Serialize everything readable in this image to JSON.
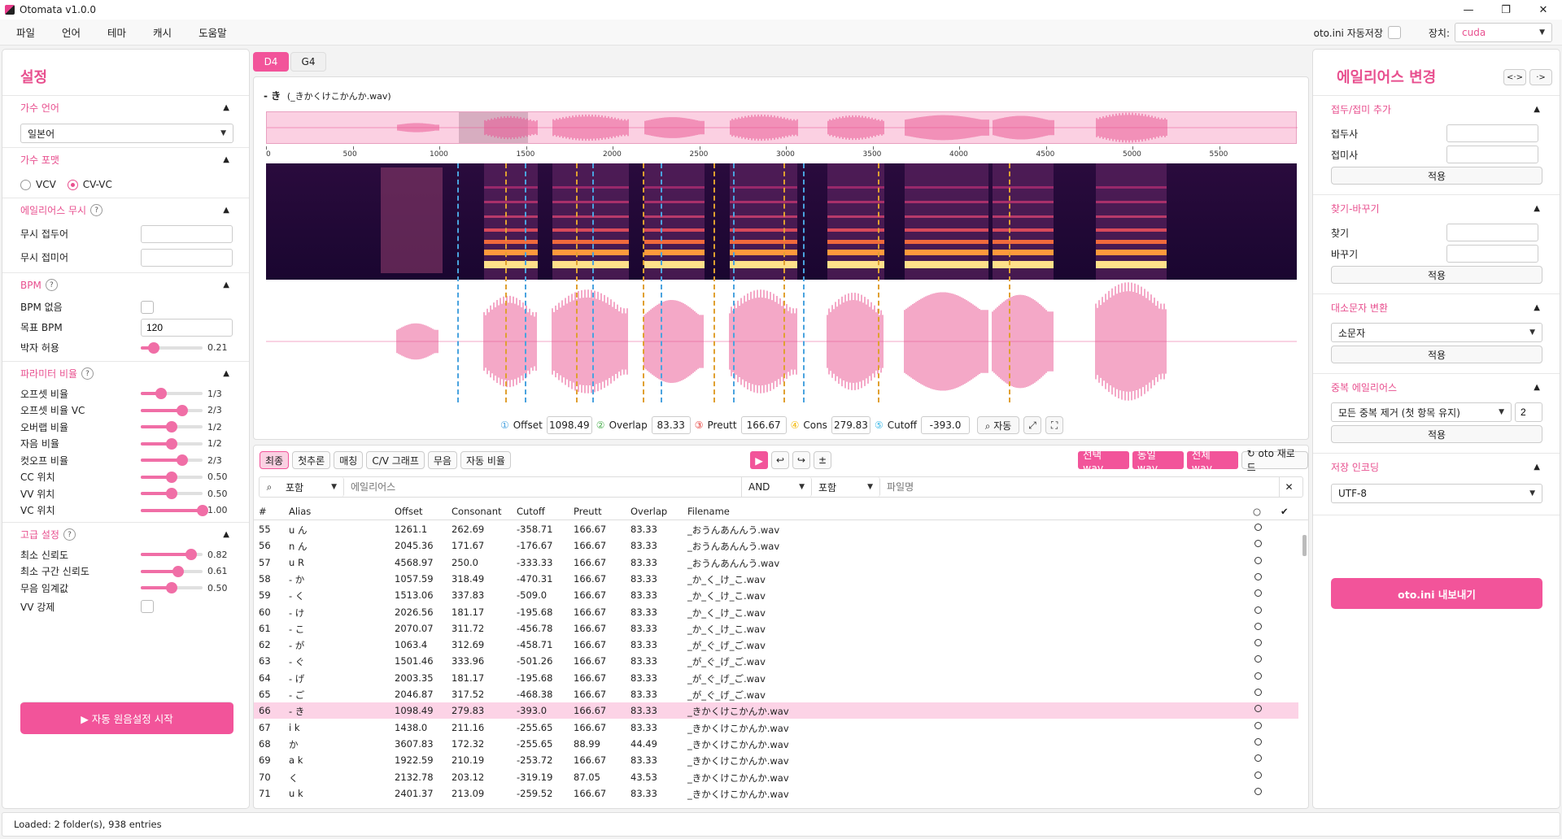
{
  "window": {
    "title": "Otomata v1.0.0"
  },
  "menu": {
    "items": [
      "파일",
      "언어",
      "테마",
      "캐시",
      "도움말"
    ],
    "autosave_label": "oto.ini 자동저장",
    "device_label": "장치:",
    "device_value": "cuda"
  },
  "left": {
    "title": "설정",
    "singer_lang": {
      "title": "가수 언어",
      "value": "일본어"
    },
    "singer_format": {
      "title": "가수 포맷",
      "opt1": "VCV",
      "opt2": "CV-VC",
      "selected": "CV-VC"
    },
    "ignore": {
      "title": "에일리어스 무시",
      "prefix": "무시 접두어",
      "suffix": "무시 접미어"
    },
    "bpm": {
      "title": "BPM",
      "none": "BPM 없음",
      "target": "목표 BPM",
      "target_value": "120",
      "tolerance": "박자 허용",
      "tolerance_value": "0.21",
      "tolerance_level": 0.21
    },
    "ratio": {
      "title": "파라미터 비율",
      "items": [
        {
          "label": "오프셋 비율",
          "value": "1/3",
          "level": 0.33
        },
        {
          "label": "오프셋 비율 VC",
          "value": "2/3",
          "level": 0.67
        },
        {
          "label": "오버랩 비율",
          "value": "1/2",
          "level": 0.5
        },
        {
          "label": "자음 비율",
          "value": "1/2",
          "level": 0.5
        },
        {
          "label": "컷오프 비율",
          "value": "2/3",
          "level": 0.67
        },
        {
          "label": "CC 위치",
          "value": "0.50",
          "level": 0.5
        },
        {
          "label": "VV 위치",
          "value": "0.50",
          "level": 0.5
        },
        {
          "label": "VC 위치",
          "value": "1.00",
          "level": 1.0
        }
      ]
    },
    "advanced": {
      "title": "고급 설정",
      "items": [
        {
          "label": "최소 신뢰도",
          "value": "0.82",
          "level": 0.82
        },
        {
          "label": "최소 구간 신뢰도",
          "value": "0.61",
          "level": 0.61
        },
        {
          "label": "무음 임계값",
          "value": "0.50",
          "level": 0.5
        }
      ],
      "vv_force": "VV 강제"
    },
    "start_button": "▶  자동 원음설정 시작"
  },
  "tabs": [
    "D4",
    "G4"
  ],
  "viewer": {
    "alias_title": "- き",
    "file_title": "(_きかくけこかんか.wav)",
    "ruler_ticks": [
      "0",
      "500",
      "1000",
      "1500",
      "2000",
      "2500",
      "3000",
      "3500",
      "4000",
      "4500",
      "5000",
      "5500"
    ],
    "params": {
      "offset_label": "Offset",
      "offset": "1098.49",
      "overlap_label": "Overlap",
      "overlap": "83.33",
      "preutt_label": "Preutt",
      "preutt": "166.67",
      "cons_label": "Cons",
      "cons": "279.83",
      "cutoff_label": "Cutoff",
      "cutoff": "-393.0",
      "auto_label": "⌕ 자동"
    },
    "colors": {
      "offset": "#4aa3df",
      "overlap": "#4caf50",
      "preutt": "#e53935",
      "cons": "#f2b705",
      "cutoff": "#35b6e6"
    }
  },
  "table": {
    "toolbar": [
      "최종",
      "첫추론",
      "매칭",
      "C/V 그래프",
      "무음",
      "자동 비율"
    ],
    "wav_buttons": [
      "선택 wav",
      "동일 wav",
      "전체 wav"
    ],
    "reload": "↻ oto 재로드",
    "filter": {
      "mode1": "포함",
      "alias_placeholder": "에일리어스",
      "op": "AND",
      "mode2": "포함",
      "file_placeholder": "파일명"
    },
    "columns": [
      "#",
      "Alias",
      "Offset",
      "Consonant",
      "Cutoff",
      "Preutt",
      "Overlap",
      "Filename",
      "○",
      "✔"
    ],
    "rows": [
      [
        "55",
        "u ん",
        "1261.1",
        "262.69",
        "-358.71",
        "166.67",
        "83.33",
        "_おうんあんんう.wav"
      ],
      [
        "56",
        "n ん",
        "2045.36",
        "171.67",
        "-176.67",
        "166.67",
        "83.33",
        "_おうんあんんう.wav"
      ],
      [
        "57",
        "u R",
        "4568.97",
        "250.0",
        "-333.33",
        "166.67",
        "83.33",
        "_おうんあんんう.wav"
      ],
      [
        "58",
        "- か",
        "1057.59",
        "318.49",
        "-470.31",
        "166.67",
        "83.33",
        "_か_く_け_こ.wav"
      ],
      [
        "59",
        "- く",
        "1513.06",
        "337.83",
        "-509.0",
        "166.67",
        "83.33",
        "_か_く_け_こ.wav"
      ],
      [
        "60",
        "- け",
        "2026.56",
        "181.17",
        "-195.68",
        "166.67",
        "83.33",
        "_か_く_け_こ.wav"
      ],
      [
        "61",
        "- こ",
        "2070.07",
        "311.72",
        "-456.78",
        "166.67",
        "83.33",
        "_か_く_け_こ.wav"
      ],
      [
        "62",
        "- が",
        "1063.4",
        "312.69",
        "-458.71",
        "166.67",
        "83.33",
        "_が_ぐ_げ_ご.wav"
      ],
      [
        "63",
        "- ぐ",
        "1501.46",
        "333.96",
        "-501.26",
        "166.67",
        "83.33",
        "_が_ぐ_げ_ご.wav"
      ],
      [
        "64",
        "- げ",
        "2003.35",
        "181.17",
        "-195.68",
        "166.67",
        "83.33",
        "_が_ぐ_げ_ご.wav"
      ],
      [
        "65",
        "- ご",
        "2046.87",
        "317.52",
        "-468.38",
        "166.67",
        "83.33",
        "_が_ぐ_げ_ご.wav"
      ],
      [
        "66",
        "- き",
        "1098.49",
        "279.83",
        "-393.0",
        "166.67",
        "83.33",
        "_きかくけこかんか.wav"
      ],
      [
        "67",
        "i k",
        "1438.0",
        "211.16",
        "-255.65",
        "166.67",
        "83.33",
        "_きかくけこかんか.wav"
      ],
      [
        "68",
        "か",
        "3607.83",
        "172.32",
        "-255.65",
        "88.99",
        "44.49",
        "_きかくけこかんか.wav"
      ],
      [
        "69",
        "a k",
        "1922.59",
        "210.19",
        "-253.72",
        "166.67",
        "83.33",
        "_きかくけこかんか.wav"
      ],
      [
        "70",
        "く",
        "2132.78",
        "203.12",
        "-319.19",
        "87.05",
        "43.53",
        "_きかくけこかんか.wav"
      ],
      [
        "71",
        "u k",
        "2401.37",
        "213.09",
        "-259.52",
        "166.67",
        "83.33",
        "_きかくけこかんか.wav"
      ]
    ],
    "selected_row": "66"
  },
  "right": {
    "title": "에일리어스 변경",
    "affix": {
      "title": "접두/접미 추가",
      "prefix": "접두사",
      "suffix": "접미사",
      "apply": "적용"
    },
    "replace": {
      "title": "찾기-바꾸기",
      "find": "찾기",
      "replace": "바꾸기",
      "apply": "적용"
    },
    "case": {
      "title": "대소문자 변환",
      "value": "소문자",
      "apply": "적용"
    },
    "dup": {
      "title": "중복 에일리어스",
      "value": "모든 중복 제거 (첫 항목 유지)",
      "count": "2",
      "apply": "적용"
    },
    "encoding": {
      "title": "저장 인코딩",
      "value": "UTF-8"
    },
    "export": "oto.ini 내보내기"
  },
  "status": "Loaded: 2 folder(s), 938 entries"
}
